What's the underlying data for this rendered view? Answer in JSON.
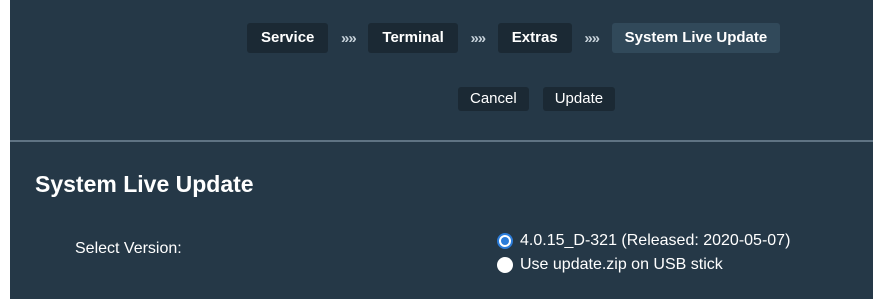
{
  "breadcrumb": {
    "items": [
      {
        "label": "Service"
      },
      {
        "label": "Terminal"
      },
      {
        "label": "Extras"
      },
      {
        "label": "System Live Update"
      }
    ],
    "separator": "»»"
  },
  "actions": {
    "cancel_label": "Cancel",
    "update_label": "Update"
  },
  "page": {
    "title": "System Live Update"
  },
  "version": {
    "label": "Select Version:",
    "options": [
      {
        "label": "4.0.15_D-321 (Released: 2020-05-07)",
        "selected": true
      },
      {
        "label": "Use update.zip on USB stick",
        "selected": false
      }
    ]
  },
  "colors": {
    "background": "#253847",
    "button": "#1b2934",
    "current_crumb": "#31495a",
    "radio_accent": "#2b7cd9"
  }
}
